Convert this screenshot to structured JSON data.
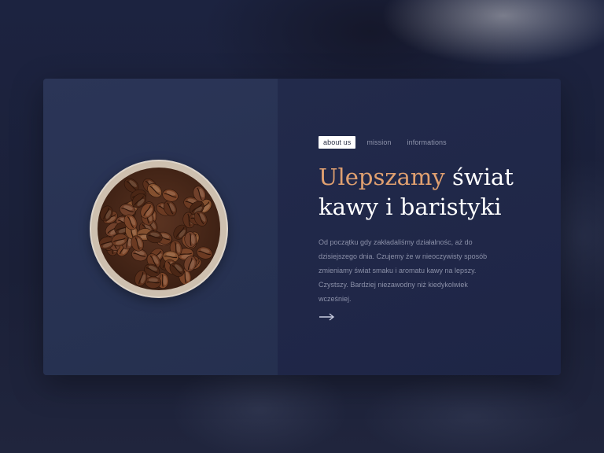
{
  "tabs": [
    {
      "label": "about us",
      "active": true
    },
    {
      "label": "mission",
      "active": false
    },
    {
      "label": "informations",
      "active": false
    }
  ],
  "heading": {
    "accent": "Ulepszamy",
    "rest_line1": " świat",
    "line2": "kawy i baristyki"
  },
  "body": "Od początku gdy zakładaliśmy działalnośc, aż do dzisiejszego dnia. Czujemy że w nieoczywisty sposób zmieniamy świat smaku i aromatu kawy na lepszy. Czystszy. Bardziej niezawodny niż kiedykolwiek wcześniej.",
  "icons": {
    "arrow": "arrow-right-icon",
    "image": "coffee-beans-jar"
  },
  "colors": {
    "accent": "#e0a070",
    "card_left": "#2b3557",
    "card_right": "#222a4b",
    "text_muted": "#8b90a8"
  }
}
